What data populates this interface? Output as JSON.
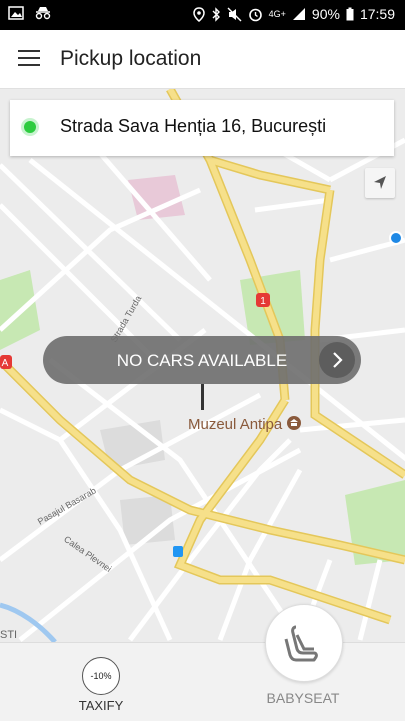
{
  "status_bar": {
    "battery": "90%",
    "time": "17:59",
    "network": "4G+"
  },
  "app_bar": {
    "title": "Pickup location",
    "menu_icon": "hamburger-menu-icon"
  },
  "pickup": {
    "address": "Strada Sava Henția 16, București"
  },
  "map": {
    "labels": {
      "poi": "Muzeul Antipa",
      "street1": "Strada Turda",
      "street2": "Pasajul Basarab",
      "street3": "Calea Plevnei",
      "route": "1",
      "edge1": "A",
      "edge2": "STI"
    }
  },
  "no_cars": {
    "label": "NO CARS AVAILABLE"
  },
  "options": [
    {
      "label": "TAXIFY",
      "badge": "-10%"
    },
    {
      "label": "BABYSEAT"
    }
  ],
  "colors": {
    "road_major": "#f4dd7a",
    "road_minor": "#ffffff",
    "park": "#c7e8b3",
    "accent_green": "#2ecc40"
  }
}
